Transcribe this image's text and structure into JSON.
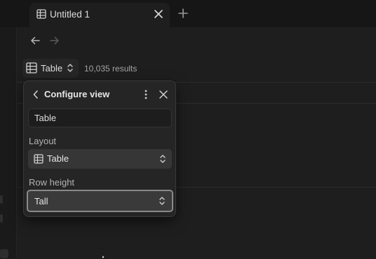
{
  "tab": {
    "title": "Untitled 1"
  },
  "toolbar": {
    "view_label": "Table",
    "results": "10,035 results"
  },
  "popover": {
    "title": "Configure view",
    "name_value": "Table",
    "layout_label": "Layout",
    "layout_value": "Table",
    "row_height_label": "Row height",
    "row_height_value": "Tall"
  },
  "colors": {
    "background": "#1e1e1e",
    "panel": "#252525",
    "text": "#dcddde"
  }
}
